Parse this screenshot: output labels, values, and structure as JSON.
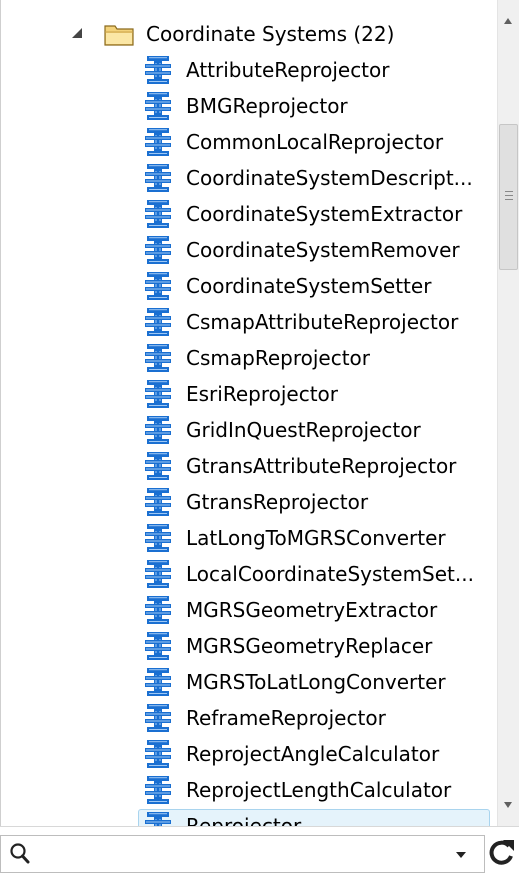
{
  "tree": {
    "folder": {
      "label": "Coordinate Systems (22)",
      "icon": "folder-icon",
      "expanded": true
    },
    "items": [
      {
        "label": "AttributeReprojector"
      },
      {
        "label": "BMGReprojector"
      },
      {
        "label": "CommonLocalReprojector"
      },
      {
        "label": "CoordinateSystemDescript..."
      },
      {
        "label": "CoordinateSystemExtractor"
      },
      {
        "label": "CoordinateSystemRemover"
      },
      {
        "label": "CoordinateSystemSetter"
      },
      {
        "label": "CsmapAttributeReprojector"
      },
      {
        "label": "CsmapReprojector"
      },
      {
        "label": "EsriReprojector"
      },
      {
        "label": "GridInQuestReprojector"
      },
      {
        "label": "GtransAttributeReprojector"
      },
      {
        "label": "GtransReprojector"
      },
      {
        "label": "LatLongToMGRSConverter"
      },
      {
        "label": "LocalCoordinateSystemSet..."
      },
      {
        "label": "MGRSGeometryExtractor"
      },
      {
        "label": "MGRSGeometryReplacer"
      },
      {
        "label": "MGRSToLatLongConverter"
      },
      {
        "label": "ReframeReprojector"
      },
      {
        "label": "ReprojectAngleCalculator"
      },
      {
        "label": "ReprojectLengthCalculator"
      },
      {
        "label": "Reprojector",
        "selected": true
      }
    ],
    "item_icon": "transformer-icon"
  },
  "search": {
    "value": "",
    "placeholder": "",
    "icon": "search-icon",
    "refresh_icon": "refresh-icon"
  },
  "colors": {
    "transformer_icon": "#1a6fd1",
    "selection_bg": "#e5f3fb",
    "selection_border": "#a9d4ee",
    "folder": "#e7c46a"
  }
}
